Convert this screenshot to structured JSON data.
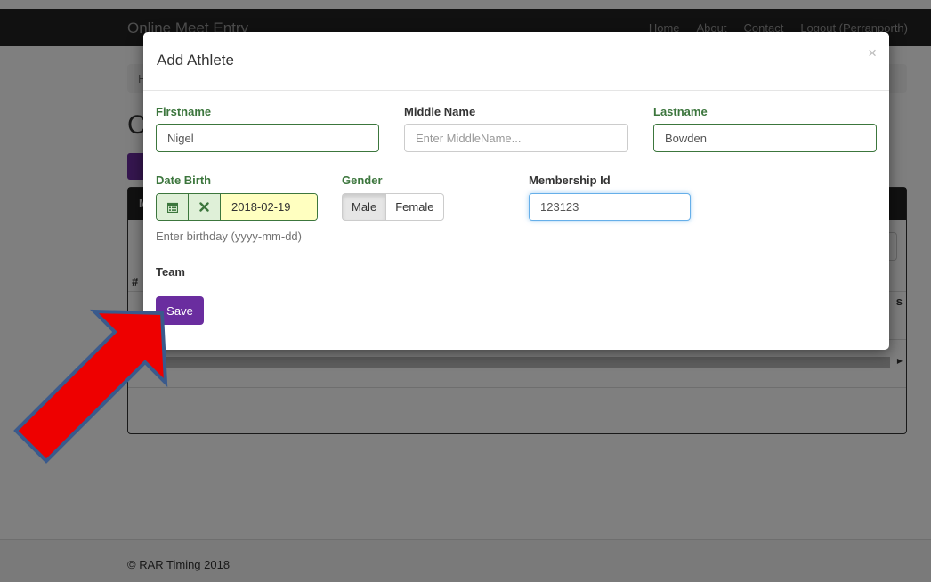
{
  "navbar": {
    "brand": "Online Meet Entry",
    "links": [
      "Home",
      "About",
      "Contact",
      "Logout (Perranporth)"
    ]
  },
  "background": {
    "breadcrumb": "H",
    "heading": "C",
    "add_button_label": "A",
    "panel_title": "M",
    "table_hash": "#",
    "table_col_end": "s"
  },
  "modal": {
    "title": "Add Athlete",
    "close_glyph": "×",
    "firstname": {
      "label": "Firstname",
      "value": "Nigel"
    },
    "middlename": {
      "label": "Middle Name",
      "value": "",
      "placeholder": "Enter MiddleName..."
    },
    "lastname": {
      "label": "Lastname",
      "value": "Bowden"
    },
    "date_birth": {
      "label": "Date Birth",
      "value": "2018-02-19",
      "help": "Enter birthday (yyyy-mm-dd)"
    },
    "gender": {
      "label": "Gender",
      "options": [
        "Male",
        "Female"
      ],
      "selected": "Male"
    },
    "membership": {
      "label": "Membership Id",
      "value": "123123"
    },
    "team": {
      "label": "Team"
    },
    "save_label": "Save"
  },
  "footer": {
    "text": "© RAR Timing 2018"
  },
  "colors": {
    "accent_purple": "#6a2d9f",
    "success_green": "#3c763d",
    "arrow_red": "#ee0000",
    "arrow_outline": "#3a5a8c"
  },
  "icons": {
    "calendar": "calendar-icon",
    "clear": "clear-x-icon",
    "close": "close-icon"
  }
}
